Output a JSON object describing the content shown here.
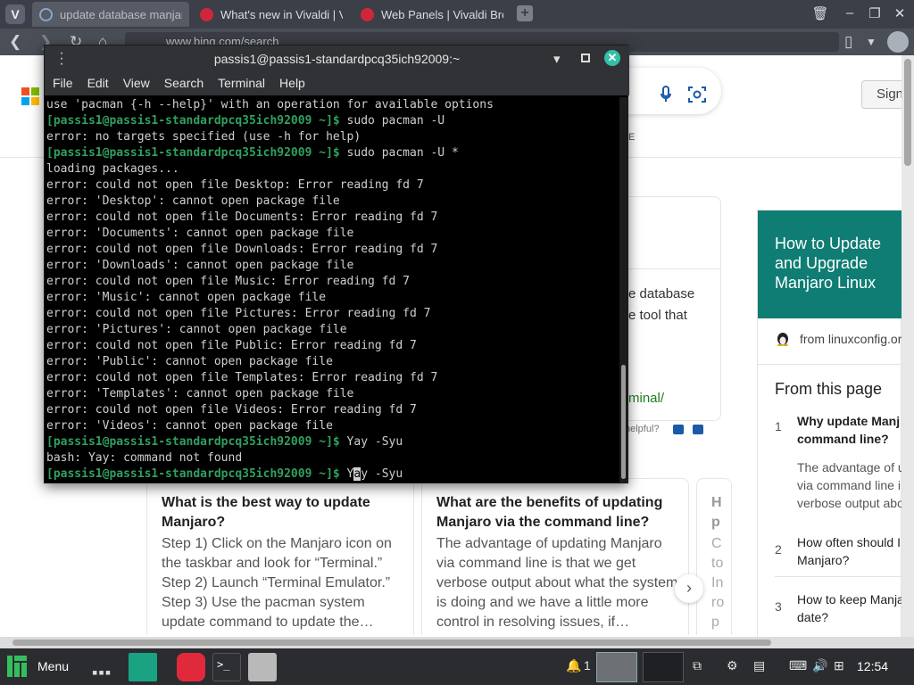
{
  "browser": {
    "tabs": [
      {
        "label": "update database manjaro"
      },
      {
        "label": "What's new in Vivaldi | Viva"
      },
      {
        "label": "Web Panels | Vivaldi Brows"
      }
    ],
    "new_tab": "+",
    "url": "www.bing.com/search"
  },
  "bing": {
    "sign_in": "Sign",
    "answer_text_1": "e database",
    "answer_text_2": "e tool that",
    "answer_link": "minal/",
    "helpful": "helpful?",
    "mini_label": "E",
    "side_panel": {
      "title": "How to Update and Upgrade Manjaro Linux",
      "source": "from linuxconfig.or",
      "from_page_title": "From this page",
      "items": [
        {
          "num": "1",
          "question": "Why update Manj",
          "question2": "command line?",
          "answer": [
            "The advantage of u",
            "via command line i",
            "verbose output abo"
          ]
        },
        {
          "num": "2",
          "question": "How often should I",
          "question2": "Manjaro?"
        },
        {
          "num": "3",
          "question": "How to keep Manja",
          "question2": "date?"
        }
      ]
    },
    "faq": [
      {
        "question": "What is the best way to update Manjaro?",
        "answer": "Step 1) Click on the Manjaro icon on the taskbar and look for “Terminal.” Step 2) Launch “Terminal Emulator.” Step 3) Use the pacman system update command to update the…"
      },
      {
        "question": "What are the benefits of updating Manjaro via the command line?",
        "answer": "The advantage of updating Manjaro via command line is that we get verbose output about what the system is doing and we have a little more control in resolving issues, if…"
      },
      {
        "question": "H p",
        "answer": "C to In ro p"
      }
    ]
  },
  "terminal": {
    "title": "passis1@passis1-standardpcq35ich92009:~",
    "menu": [
      "File",
      "Edit",
      "View",
      "Search",
      "Terminal",
      "Help"
    ],
    "lines": [
      {
        "prompt": "",
        "text": "use 'pacman {-h --help}' with an operation for available options"
      },
      {
        "prompt": "[passis1@passis1-standardpcq35ich92009 ~]$",
        "text": " sudo pacman -U"
      },
      {
        "prompt": "",
        "text": "error: no targets specified (use -h for help)"
      },
      {
        "prompt": "[passis1@passis1-standardpcq35ich92009 ~]$",
        "text": " sudo pacman -U *"
      },
      {
        "prompt": "",
        "text": "loading packages..."
      },
      {
        "prompt": "",
        "text": "error: could not open file Desktop: Error reading fd 7"
      },
      {
        "prompt": "",
        "text": "error: 'Desktop': cannot open package file"
      },
      {
        "prompt": "",
        "text": "error: could not open file Documents: Error reading fd 7"
      },
      {
        "prompt": "",
        "text": "error: 'Documents': cannot open package file"
      },
      {
        "prompt": "",
        "text": "error: could not open file Downloads: Error reading fd 7"
      },
      {
        "prompt": "",
        "text": "error: 'Downloads': cannot open package file"
      },
      {
        "prompt": "",
        "text": "error: could not open file Music: Error reading fd 7"
      },
      {
        "prompt": "",
        "text": "error: 'Music': cannot open package file"
      },
      {
        "prompt": "",
        "text": "error: could not open file Pictures: Error reading fd 7"
      },
      {
        "prompt": "",
        "text": "error: 'Pictures': cannot open package file"
      },
      {
        "prompt": "",
        "text": "error: could not open file Public: Error reading fd 7"
      },
      {
        "prompt": "",
        "text": "error: 'Public': cannot open package file"
      },
      {
        "prompt": "",
        "text": "error: could not open file Templates: Error reading fd 7"
      },
      {
        "prompt": "",
        "text": "error: 'Templates': cannot open package file"
      },
      {
        "prompt": "",
        "text": "error: could not open file Videos: Error reading fd 7"
      },
      {
        "prompt": "",
        "text": "error: 'Videos': cannot open package file"
      },
      {
        "prompt": "[passis1@passis1-standardpcq35ich92009 ~]$",
        "text": " Yay -Syu"
      },
      {
        "prompt": "",
        "text": "bash: Yay: command not found"
      }
    ],
    "current_prompt": "[passis1@passis1-standardpcq35ich92009 ~]$",
    "current_input_before": " Y",
    "current_input_cursor": "a",
    "current_input_after": "y -Syu"
  },
  "taskbar": {
    "menu_label": "Menu",
    "notifications_count": "1",
    "clock": "12:54"
  },
  "colors": {
    "prompt_green": "#2fa060",
    "bing_teal": "#0f7d74",
    "vivaldi_red": "#e02a3c"
  }
}
